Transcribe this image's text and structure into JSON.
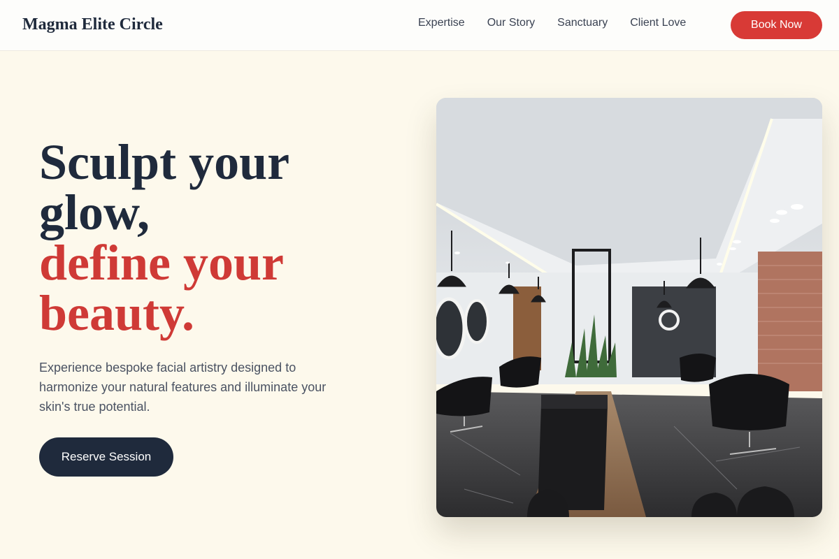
{
  "brand": "Magma Elite Circle",
  "nav": {
    "links": [
      "Expertise",
      "Our Story",
      "Sanctuary",
      "Client Love"
    ],
    "cta": "Book Now"
  },
  "hero": {
    "line1": "Sculpt your",
    "line2": "glow,",
    "line3": "define your",
    "line4": "beauty.",
    "description": "Experience bespoke facial artistry designed to harmonize your natural features and illuminate your skin's true potential.",
    "button": "Reserve Session"
  },
  "image": {
    "alt": "Salon interior with black chairs, marble floor and pendant lamps"
  },
  "colors": {
    "accent": "#d83a36",
    "dark": "#1f2a3c",
    "background": "#fdf9ec"
  }
}
